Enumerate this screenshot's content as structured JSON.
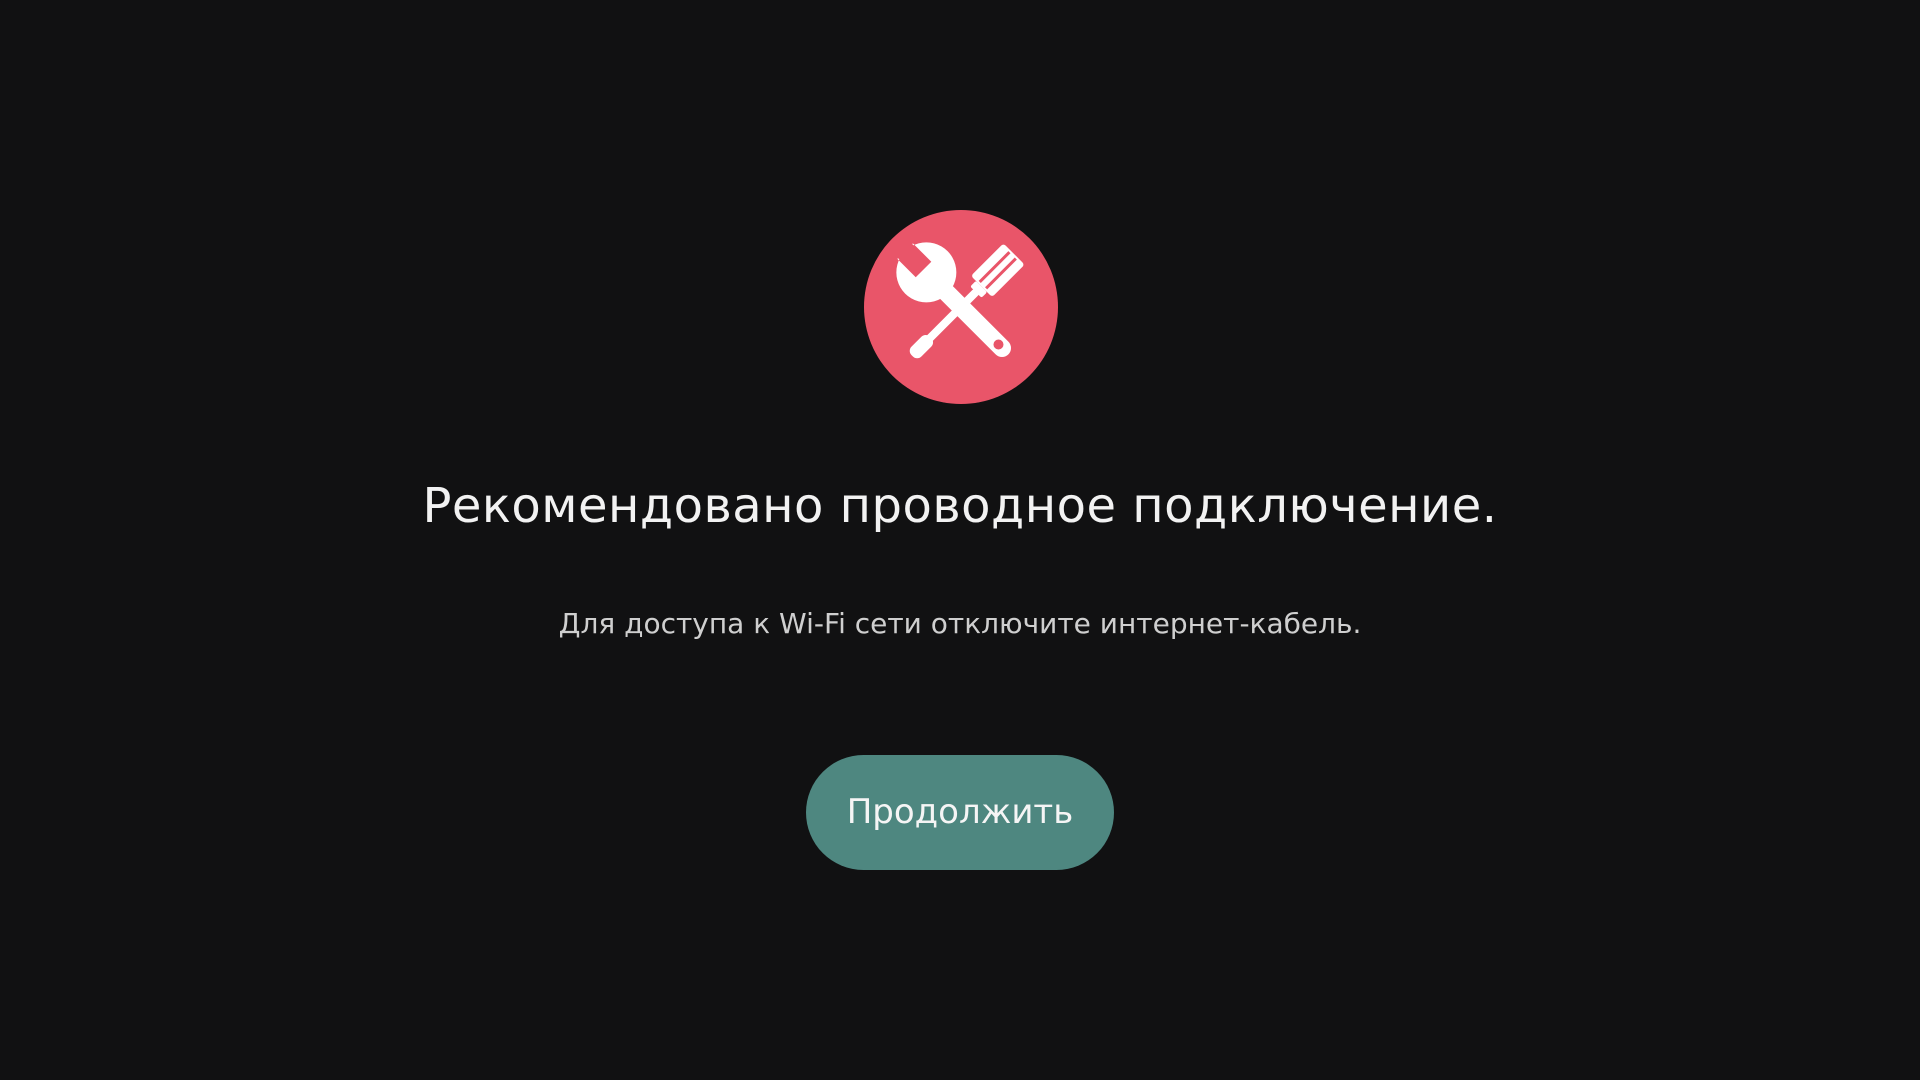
{
  "dialog": {
    "icon": "tools-icon",
    "accent_color": "#e95569",
    "title": "Рекомендовано проводное подключение.",
    "message": "Для доступа к Wi-Fi сети отключите интернет-кабель.",
    "continue_label": "Продолжить",
    "button_color": "#4e8780",
    "background_color": "#111112"
  }
}
